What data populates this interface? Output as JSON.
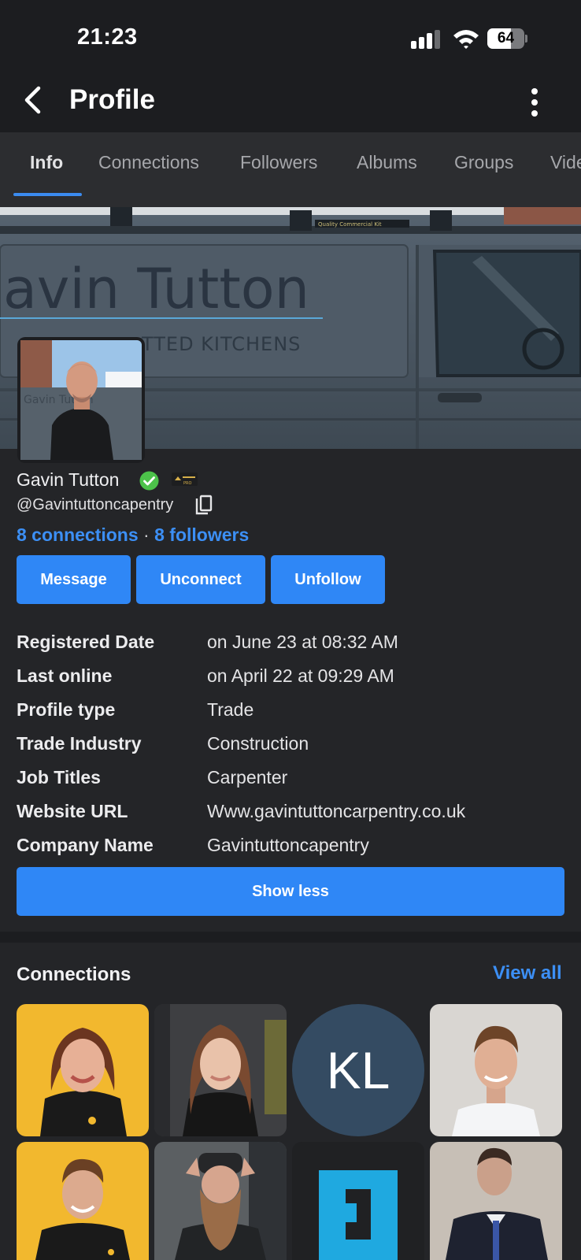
{
  "status_bar": {
    "time": "21:23",
    "battery": "64",
    "battery_level": 0.64,
    "signal_bars": 3
  },
  "header": {
    "title": "Profile"
  },
  "tabs": [
    {
      "label": "Info",
      "active": true
    },
    {
      "label": "Connections",
      "active": false
    },
    {
      "label": "Followers",
      "active": false
    },
    {
      "label": "Albums",
      "active": false
    },
    {
      "label": "Groups",
      "active": false
    },
    {
      "label": "Vide",
      "active": false
    }
  ],
  "cover": {
    "line1": "avin Tutton",
    "line2": "TTED KITCHENS",
    "roof_label": "Quality Commercial Kit"
  },
  "profile": {
    "name": "Gavin Tutton",
    "handle": "@Gavintuttoncapentry",
    "badge_text": "PRO",
    "connections": "8 connections",
    "separator": "·",
    "followers": "8 followers"
  },
  "actions": {
    "message": "Message",
    "unconnect": "Unconnect",
    "unfollow": "Unfollow"
  },
  "details": [
    {
      "label": "Registered Date",
      "value": "on June 23 at 08:32 AM"
    },
    {
      "label": "Last online",
      "value": "on April 22 at 09:29 AM"
    },
    {
      "label": "Profile type",
      "value": "Trade"
    },
    {
      "label": "Trade Industry",
      "value": "Construction"
    },
    {
      "label": "Job Titles",
      "value": "Carpenter"
    },
    {
      "label": "Website URL",
      "value": "Www.gavintuttoncarpentry.co.uk"
    },
    {
      "label": "Company Name",
      "value": "Gavintuttoncapentry"
    }
  ],
  "show_less": "Show less",
  "connections_section": {
    "title": "Connections",
    "view_all": "View all",
    "initials": "KL"
  },
  "colors": {
    "accent": "#2f87f6",
    "link": "#3c8ff5",
    "background": "#242528",
    "verified": "#4cc24a"
  }
}
